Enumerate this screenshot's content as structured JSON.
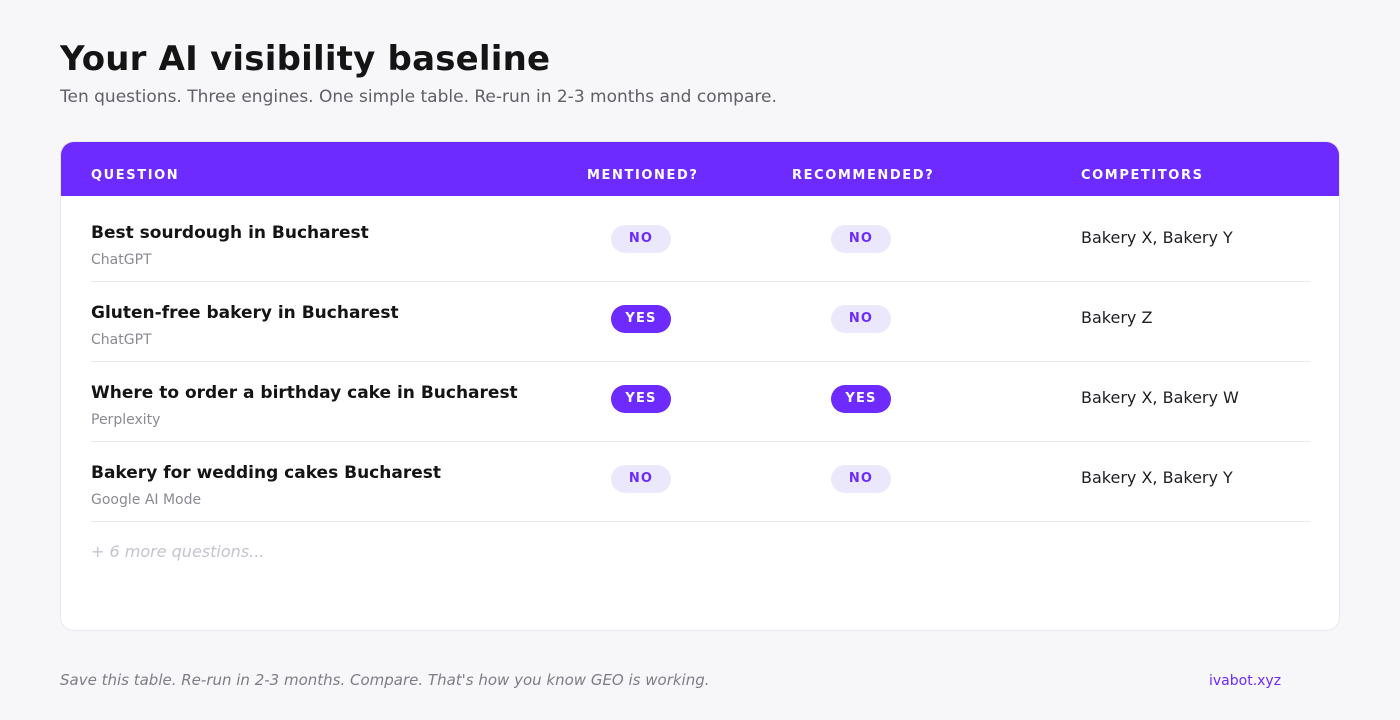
{
  "header": {
    "title": "Your AI visibility baseline",
    "subtitle": "Ten questions. Three engines. One simple table. Re-run in 2-3 months and compare."
  },
  "table": {
    "columns": {
      "question": "QUESTION",
      "mentioned": "MENTIONED?",
      "recommended": "RECOMMENDED?",
      "competitors": "COMPETITORS"
    },
    "rows": [
      {
        "question": "Best sourdough in Bucharest",
        "engine": "ChatGPT",
        "mentioned": "NO",
        "recommended": "NO",
        "competitors": "Bakery X, Bakery Y"
      },
      {
        "question": "Gluten-free bakery in Bucharest",
        "engine": "ChatGPT",
        "mentioned": "YES",
        "recommended": "NO",
        "competitors": "Bakery Z"
      },
      {
        "question": "Where to order a birthday cake in Bucharest",
        "engine": "Perplexity",
        "mentioned": "YES",
        "recommended": "YES",
        "competitors": "Bakery X, Bakery W"
      },
      {
        "question": "Bakery for wedding cakes Bucharest",
        "engine": "Google AI Mode",
        "mentioned": "NO",
        "recommended": "NO",
        "competitors": "Bakery X, Bakery Y"
      }
    ],
    "more_label": "+ 6 more questions..."
  },
  "footer": {
    "note": "Save this table. Re-run in 2-3 months. Compare. That's how you know GEO is working.",
    "link": "ivabot.xyz"
  },
  "colors": {
    "accent": "#6d2bff",
    "badge_no_bg": "#ece8fb",
    "background": "#f7f7f9"
  }
}
